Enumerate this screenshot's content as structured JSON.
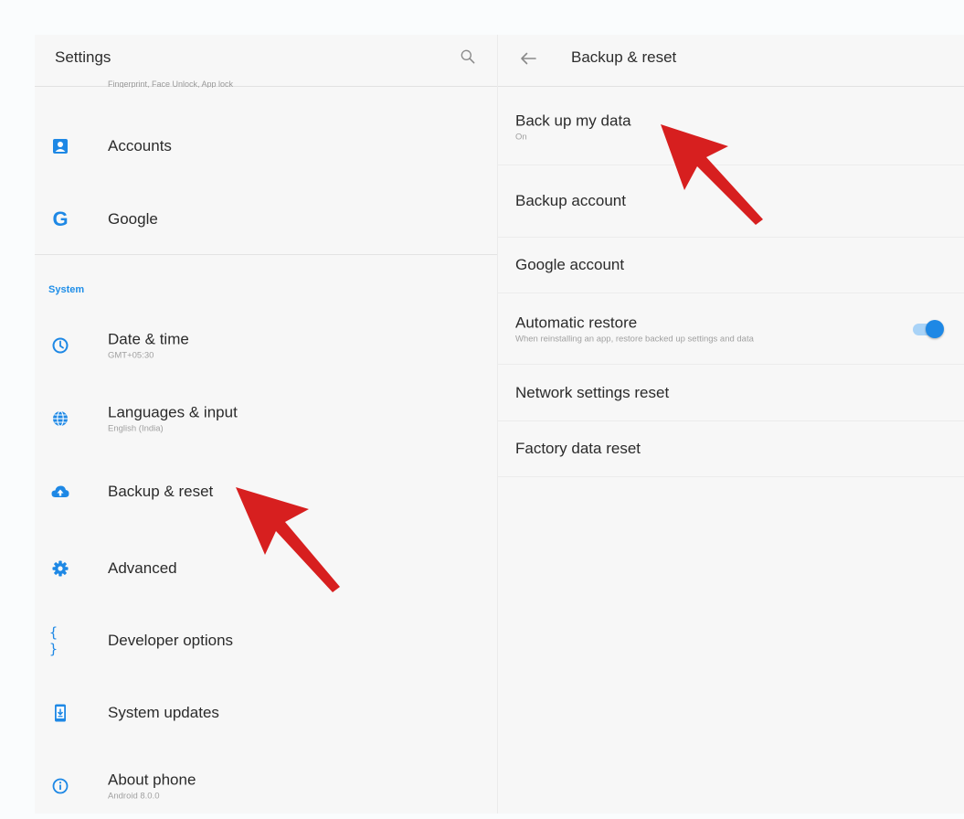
{
  "left_panel": {
    "title": "Settings",
    "cut_subtitle": "Fingerprint, Face Unlock, App lock",
    "items_top": [
      {
        "label": "Accounts",
        "icon": "account-box-icon"
      },
      {
        "label": "Google",
        "icon": "google-g-icon"
      }
    ],
    "section_label": "System",
    "items_system": [
      {
        "label": "Date & time",
        "subtitle": "GMT+05:30",
        "icon": "clock-icon"
      },
      {
        "label": "Languages & input",
        "subtitle": "English (India)",
        "icon": "globe-icon"
      },
      {
        "label": "Backup & reset",
        "icon": "cloud-upload-icon"
      },
      {
        "label": "Advanced",
        "icon": "gear-icon"
      },
      {
        "label": "Developer options",
        "icon": "braces-icon"
      },
      {
        "label": "System updates",
        "icon": "system-update-icon"
      },
      {
        "label": "About phone",
        "subtitle": "Android 8.0.0",
        "icon": "info-icon"
      }
    ]
  },
  "right_panel": {
    "title": "Backup & reset",
    "items": [
      {
        "label": "Back up my data",
        "subtitle": "On"
      },
      {
        "label": "Backup account"
      },
      {
        "label": "Google account"
      },
      {
        "label": "Automatic restore",
        "subtitle": "When reinstalling an app, restore backed up settings and data",
        "toggle_on": true
      },
      {
        "label": "Network settings reset"
      },
      {
        "label": "Factory data reset"
      }
    ]
  },
  "colors": {
    "accent": "#1e88e5",
    "arrow": "#d71f1f",
    "section_label": "#1f8ee8"
  }
}
